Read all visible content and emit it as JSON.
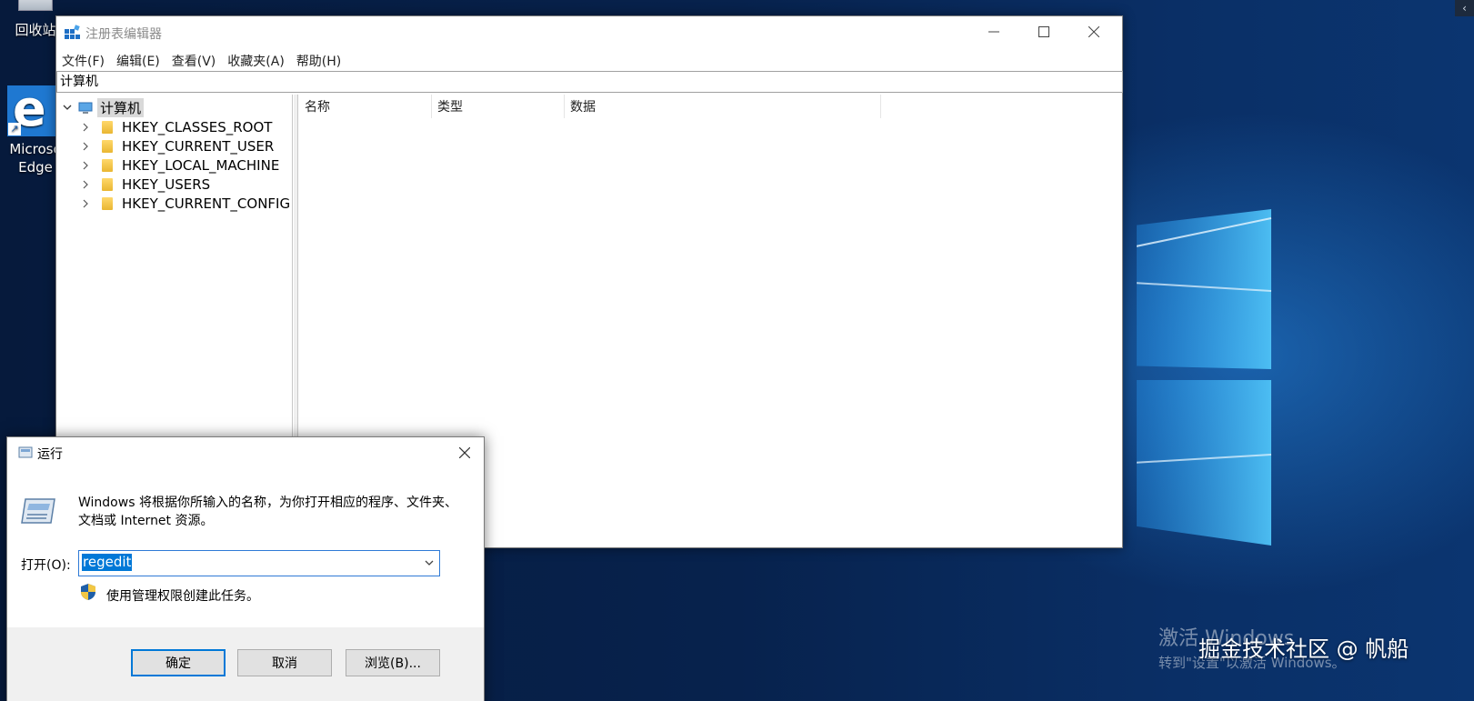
{
  "desktop": {
    "recycle_label": "回收站",
    "edge_label_line1": "Microso",
    "edge_label_line2": "Edge",
    "edge_glyph": "e",
    "activation_line1": "激活 Windows",
    "activation_line2": "转到\"设置\"以激活 Windows。",
    "watermark": "掘金技术社区 @ 帆船",
    "corner_glyph": "‹"
  },
  "regedit": {
    "title": "注册表编辑器",
    "menu": [
      "文件(F)",
      "编辑(E)",
      "查看(V)",
      "收藏夹(A)",
      "帮助(H)"
    ],
    "address": "计算机",
    "tree": {
      "root": "计算机",
      "children": [
        "HKEY_CLASSES_ROOT",
        "HKEY_CURRENT_USER",
        "HKEY_LOCAL_MACHINE",
        "HKEY_USERS",
        "HKEY_CURRENT_CONFIG"
      ]
    },
    "columns": [
      "名称",
      "类型",
      "数据"
    ]
  },
  "run_dialog": {
    "title": "运行",
    "description": "Windows 将根据你所输入的名称，为你打开相应的程序、文件夹、文档或 Internet 资源。",
    "open_label": "打开(O):",
    "input_value": "regedit",
    "admin_note": "使用管理权限创建此任务。",
    "ok_button": "确定",
    "cancel_button": "取消",
    "browse_button": "浏览(B)..."
  },
  "icons": {
    "recycle": "recycle-bin-icon",
    "edge": "edge-icon",
    "regedit_app": "registry-editor-icon",
    "minimize": "minimize-icon",
    "maximize": "maximize-icon",
    "close": "close-icon",
    "computer": "computer-icon",
    "folder": "folder-icon",
    "expand": "chevron-right-icon",
    "collapse": "chevron-down-icon",
    "run": "run-icon",
    "shield": "uac-shield-icon",
    "dropdown": "chevron-down-icon"
  },
  "colors": {
    "accent": "#0078d7",
    "folder": "#f2c744",
    "desktop_bg": "#07224d"
  }
}
